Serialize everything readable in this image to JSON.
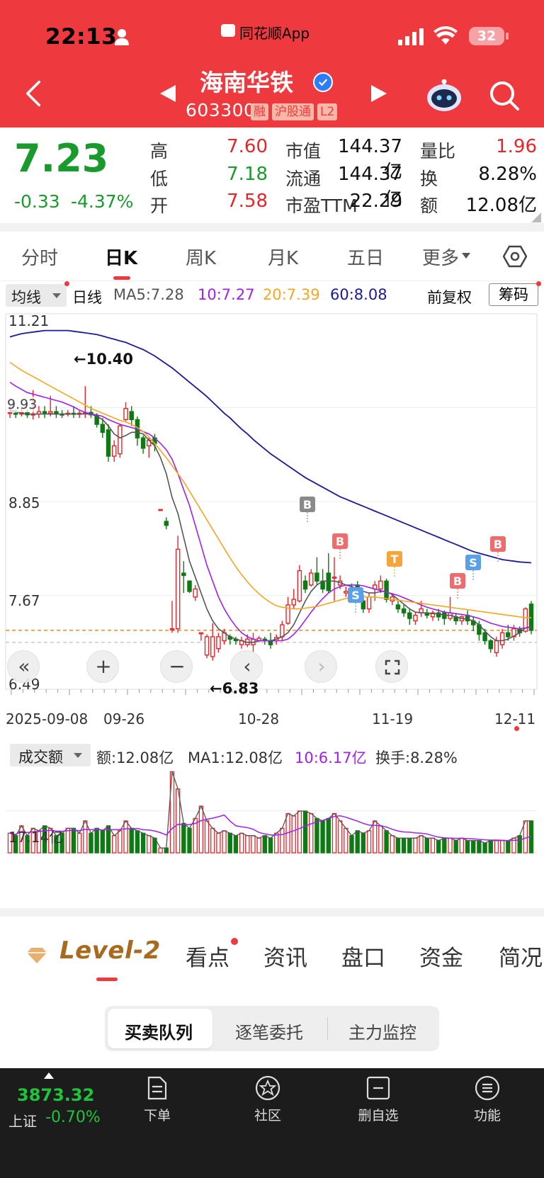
{
  "status_bar": {
    "time": "22:13",
    "app_label": "同花顺App",
    "battery": "32"
  },
  "header": {
    "stock_name": "海南华铁",
    "stock_code": "603300",
    "badges": [
      "融",
      "沪股通",
      "L2"
    ]
  },
  "quote": {
    "price": "7.23",
    "change": "-0.33",
    "change_pct": "-4.37%",
    "high_label": "高",
    "high": "7.60",
    "low_label": "低",
    "low": "7.18",
    "open_label": "开",
    "open": "7.58",
    "mktcap_label": "市值",
    "mktcap": "144.37亿",
    "float_label": "流通",
    "float_cap": "144.37亿",
    "pe_label": "市盈TTM",
    "pe": "22.29",
    "volratio_label": "量比",
    "volratio": "1.96",
    "turnover_label": "换",
    "turnover": "8.28%",
    "amount_label": "额",
    "amount": "12.08亿"
  },
  "period_tabs": [
    "分时",
    "日K",
    "周K",
    "月K",
    "五日",
    "更多"
  ],
  "ma_legend": {
    "selector": "均线",
    "period": "日线",
    "ma5": "MA5:7.28",
    "ma10": "10:7.27",
    "ma20": "20:7.39",
    "ma60": "60:8.08",
    "adjust": "前复权",
    "chip_button": "筹码"
  },
  "colors": {
    "up": "#e8252b",
    "down": "#0e7a14",
    "ma5": "#555555",
    "ma10": "#a020f0",
    "ma20": "#f5a623",
    "ma60": "#1a1a9c",
    "brand": "#ee3a3f"
  },
  "price_axis": {
    "top": "11.21",
    "mid": "8.85",
    "low": "7.67",
    "bottom": "6.49"
  },
  "annotations": {
    "high_marker": "←10.40",
    "low_marker": "←6.83",
    "price_tag": "9.93"
  },
  "date_axis": [
    "2025-09-08",
    "09-26",
    "10-28",
    "11-19",
    "12-11"
  ],
  "signal_tags": [
    "B",
    "B",
    "S",
    "T",
    "B",
    "S",
    "B"
  ],
  "volume_legend": {
    "selector": "成交额",
    "amount": "额:12.08亿",
    "ma1": "MA1:12.08亿",
    "ma10": "10:6.17亿",
    "turnover": "换手:8.28%",
    "axis_label": "17.14亿"
  },
  "chart_data": {
    "type": "candlestick",
    "title": "",
    "xlabel": "",
    "ylabel": "",
    "ylim": [
      6.49,
      11.21
    ],
    "x_ticks": [
      "2025-09-08",
      "09-26",
      "10-28",
      "11-19",
      "12-11"
    ],
    "candles": [
      [
        9.97,
        9.97,
        9.9,
        10.05
      ],
      [
        9.96,
        9.95,
        9.9,
        10.0
      ],
      [
        9.95,
        9.97,
        9.92,
        10.02
      ],
      [
        9.97,
        9.94,
        9.9,
        10.0
      ],
      [
        9.94,
        9.95,
        9.88,
        10.25
      ],
      [
        9.95,
        9.98,
        9.9,
        10.05
      ],
      [
        9.98,
        9.96,
        9.9,
        10.05
      ],
      [
        9.96,
        9.98,
        9.92,
        10.18
      ],
      [
        9.98,
        9.95,
        9.9,
        10.05
      ],
      [
        9.95,
        9.94,
        9.9,
        10.0
      ],
      [
        9.95,
        9.96,
        9.92,
        10.0
      ],
      [
        9.96,
        9.95,
        9.9,
        10.05
      ],
      [
        9.95,
        9.96,
        9.9,
        10.0
      ],
      [
        9.96,
        9.97,
        9.9,
        10.3
      ],
      [
        9.97,
        9.94,
        9.9,
        10.05
      ],
      [
        9.93,
        9.82,
        9.78,
        9.96
      ],
      [
        9.82,
        9.72,
        9.65,
        9.9
      ],
      [
        9.75,
        9.42,
        9.35,
        9.82
      ],
      [
        9.42,
        9.55,
        9.35,
        9.62
      ],
      [
        9.45,
        9.8,
        9.4,
        9.83
      ],
      [
        9.88,
        10.02,
        9.86,
        10.1
      ],
      [
        9.98,
        9.88,
        9.8,
        10.05
      ],
      [
        9.88,
        9.65,
        9.55,
        9.92
      ],
      [
        9.65,
        9.52,
        9.45,
        9.68
      ],
      [
        9.55,
        9.62,
        9.4,
        9.66
      ],
      [
        9.65,
        9.58,
        9.48,
        9.7
      ],
      [
        8.75,
        8.75,
        8.75,
        8.75
      ],
      [
        8.6,
        8.55,
        8.5,
        8.65
      ],
      [
        7.25,
        7.25,
        7.2,
        7.6
      ],
      [
        7.25,
        8.25,
        7.2,
        8.42
      ],
      [
        7.95,
        7.92,
        7.7,
        8.1
      ],
      [
        7.85,
        7.72,
        7.7,
        7.86
      ],
      [
        7.65,
        7.75,
        7.6,
        7.8
      ],
      [
        7.2,
        7.2,
        7.1,
        7.2
      ],
      [
        6.92,
        7.15,
        6.88,
        7.18
      ],
      [
        6.9,
        7.15,
        6.85,
        7.32
      ],
      [
        7.0,
        7.15,
        6.95,
        7.2
      ],
      [
        7.1,
        7.2,
        7.05,
        7.25
      ],
      [
        7.15,
        7.12,
        7.05,
        7.18
      ],
      [
        7.12,
        7.1,
        7.05,
        7.15
      ],
      [
        7.05,
        7.1,
        7.0,
        7.15
      ],
      [
        7.05,
        7.12,
        7.02,
        7.18
      ],
      [
        7.05,
        7.12,
        6.95,
        7.2
      ],
      [
        7.1,
        7.13,
        7.08,
        7.16
      ],
      [
        7.12,
        7.1,
        7.05,
        7.15
      ],
      [
        7.1,
        7.05,
        7.0,
        7.2
      ],
      [
        7.1,
        7.14,
        7.05,
        7.18
      ],
      [
        7.15,
        7.3,
        7.1,
        7.35
      ],
      [
        7.32,
        7.55,
        7.3,
        7.65
      ],
      [
        7.55,
        7.62,
        7.5,
        7.75
      ],
      [
        7.6,
        7.98,
        7.58,
        8.05
      ],
      [
        7.85,
        7.75,
        7.7,
        7.92
      ],
      [
        7.8,
        7.95,
        7.78,
        8.0
      ],
      [
        7.95,
        7.85,
        7.8,
        8.15
      ],
      [
        7.85,
        7.75,
        7.7,
        8.0
      ],
      [
        7.95,
        7.73,
        7.7,
        8.2
      ],
      [
        7.9,
        7.9,
        7.6,
        8.15
      ],
      [
        7.8,
        7.85,
        7.75,
        7.92
      ],
      [
        7.7,
        7.72,
        7.65,
        7.78
      ],
      [
        7.75,
        7.65,
        7.6,
        7.82
      ],
      [
        7.8,
        7.7,
        7.6,
        7.85
      ],
      [
        7.6,
        7.5,
        7.45,
        7.68
      ],
      [
        7.5,
        7.65,
        7.45,
        7.7
      ],
      [
        7.75,
        7.8,
        7.6,
        7.85
      ],
      [
        7.75,
        7.85,
        7.7,
        7.92
      ],
      [
        7.85,
        7.62,
        7.58,
        7.88
      ],
      [
        7.6,
        7.65,
        7.55,
        7.7
      ],
      [
        7.55,
        7.5,
        7.45,
        7.6
      ],
      [
        7.5,
        7.45,
        7.4,
        7.55
      ],
      [
        7.45,
        7.38,
        7.3,
        7.5
      ],
      [
        7.35,
        7.42,
        7.3,
        7.46
      ],
      [
        7.45,
        7.5,
        7.4,
        7.6
      ],
      [
        7.45,
        7.42,
        7.38,
        7.5
      ],
      [
        7.4,
        7.45,
        7.35,
        7.48
      ],
      [
        7.45,
        7.4,
        7.35,
        7.5
      ],
      [
        7.45,
        7.38,
        7.3,
        7.48
      ],
      [
        7.38,
        7.45,
        7.35,
        7.65
      ],
      [
        7.4,
        7.35,
        7.3,
        7.45
      ],
      [
        7.35,
        7.4,
        7.3,
        7.42
      ],
      [
        7.42,
        7.35,
        7.3,
        7.48
      ],
      [
        7.35,
        7.3,
        7.22,
        7.4
      ],
      [
        7.3,
        7.18,
        7.1,
        7.35
      ],
      [
        7.2,
        7.1,
        7.05,
        7.25
      ],
      [
        7.1,
        7.0,
        6.95,
        7.12
      ],
      [
        6.95,
        7.1,
        6.9,
        7.15
      ],
      [
        7.05,
        7.2,
        7.0,
        7.25
      ],
      [
        7.2,
        7.15,
        7.1,
        7.3
      ],
      [
        7.15,
        7.25,
        7.1,
        7.3
      ],
      [
        7.25,
        7.2,
        7.15,
        7.28
      ],
      [
        7.22,
        7.5,
        7.2,
        7.52
      ],
      [
        7.56,
        7.23,
        7.18,
        7.6
      ]
    ],
    "ma_series": [
      {
        "name": "MA5",
        "values": [
          10.0,
          9.98,
          9.96,
          9.95,
          9.95,
          9.95,
          9.95,
          9.95,
          9.95,
          9.95,
          9.95,
          9.95,
          9.95,
          9.95,
          9.95,
          9.92,
          9.88,
          9.8,
          9.7,
          9.65,
          9.68,
          9.72,
          9.72,
          9.7,
          9.62,
          9.55,
          9.4,
          9.2,
          8.9,
          8.7,
          8.4,
          8.1,
          7.9,
          7.7,
          7.5,
          7.35,
          7.25,
          7.2,
          7.15,
          7.12,
          7.1,
          7.08,
          7.08,
          7.1,
          7.1,
          7.1,
          7.12,
          7.15,
          7.2,
          7.3,
          7.45,
          7.6,
          7.72,
          7.8,
          7.85,
          7.85,
          7.85,
          7.83,
          7.8,
          7.78,
          7.75,
          7.72,
          7.7,
          7.7,
          7.72,
          7.72,
          7.68,
          7.62,
          7.56,
          7.5,
          7.46,
          7.45,
          7.45,
          7.44,
          7.44,
          7.42,
          7.42,
          7.4,
          7.38,
          7.37,
          7.35,
          7.3,
          7.22,
          7.15,
          7.1,
          7.1,
          7.12,
          7.16,
          7.2,
          7.26,
          7.28
        ]
      },
      {
        "name": "MA10",
        "values": [
          10.35,
          10.3,
          10.26,
          10.22,
          10.2,
          10.18,
          10.16,
          10.14,
          10.12,
          10.1,
          10.07,
          10.04,
          10.0,
          9.97,
          9.95,
          9.94,
          9.92,
          9.88,
          9.85,
          9.82,
          9.8,
          9.78,
          9.76,
          9.73,
          9.7,
          9.65,
          9.58,
          9.5,
          9.38,
          9.2,
          9.0,
          8.8,
          8.55,
          8.3,
          8.05,
          7.85,
          7.65,
          7.5,
          7.38,
          7.28,
          7.2,
          7.15,
          7.12,
          7.1,
          7.1,
          7.1,
          7.1,
          7.1,
          7.12,
          7.18,
          7.26,
          7.36,
          7.46,
          7.55,
          7.63,
          7.7,
          7.75,
          7.78,
          7.8,
          7.8,
          7.8,
          7.79,
          7.77,
          7.75,
          7.73,
          7.71,
          7.69,
          7.67,
          7.64,
          7.61,
          7.58,
          7.55,
          7.52,
          7.5,
          7.48,
          7.46,
          7.45,
          7.44,
          7.43,
          7.42,
          7.4,
          7.38,
          7.35,
          7.32,
          7.3,
          7.28,
          7.27,
          7.26,
          7.25,
          7.26,
          7.27
        ]
      },
      {
        "name": "MA20",
        "values": [
          10.6,
          10.55,
          10.5,
          10.46,
          10.42,
          10.38,
          10.34,
          10.3,
          10.26,
          10.22,
          10.18,
          10.14,
          10.1,
          10.06,
          10.02,
          9.99,
          9.96,
          9.93,
          9.9,
          9.87,
          9.85,
          9.82,
          9.78,
          9.73,
          9.66,
          9.58,
          9.49,
          9.4,
          9.3,
          9.2,
          9.1,
          8.98,
          8.86,
          8.74,
          8.62,
          8.5,
          8.38,
          8.26,
          8.14,
          8.03,
          7.93,
          7.84,
          7.76,
          7.69,
          7.63,
          7.58,
          7.54,
          7.52,
          7.51,
          7.5,
          7.5,
          7.51,
          7.52,
          7.53,
          7.55,
          7.57,
          7.59,
          7.61,
          7.63,
          7.64,
          7.65,
          7.65,
          7.65,
          7.65,
          7.64,
          7.63,
          7.62,
          7.61,
          7.6,
          7.59,
          7.58,
          7.57,
          7.56,
          7.55,
          7.54,
          7.53,
          7.52,
          7.51,
          7.5,
          7.49,
          7.48,
          7.47,
          7.46,
          7.45,
          7.44,
          7.43,
          7.42,
          7.41,
          7.4,
          7.39,
          7.39
        ]
      },
      {
        "name": "MA60",
        "values": [
          10.92,
          10.94,
          10.96,
          10.97,
          10.98,
          10.99,
          11.0,
          11.0,
          11.0,
          11.0,
          11.0,
          10.99,
          10.98,
          10.97,
          10.96,
          10.95,
          10.93,
          10.91,
          10.89,
          10.87,
          10.85,
          10.82,
          10.79,
          10.76,
          10.72,
          10.68,
          10.63,
          10.58,
          10.53,
          10.47,
          10.41,
          10.35,
          10.29,
          10.23,
          10.17,
          10.1,
          10.03,
          9.96,
          9.9,
          9.83,
          9.76,
          9.7,
          9.63,
          9.57,
          9.51,
          9.45,
          9.4,
          9.35,
          9.3,
          9.25,
          9.2,
          9.15,
          9.11,
          9.07,
          9.03,
          8.99,
          8.95,
          8.91,
          8.88,
          8.85,
          8.82,
          8.79,
          8.76,
          8.73,
          8.7,
          8.67,
          8.64,
          8.61,
          8.58,
          8.55,
          8.52,
          8.49,
          8.46,
          8.43,
          8.4,
          8.37,
          8.34,
          8.31,
          8.28,
          8.25,
          8.22,
          8.2,
          8.18,
          8.16,
          8.14,
          8.12,
          8.11,
          8.1,
          8.09,
          8.085,
          8.08
        ]
      }
    ],
    "volume_ylim": [
      0,
      34
    ],
    "volume_values": [
      8,
      7,
      11,
      7,
      10,
      9,
      11,
      10,
      7,
      8,
      10,
      10,
      8,
      13,
      8,
      10,
      9,
      11,
      7,
      9,
      13,
      10,
      9,
      8,
      7,
      6,
      2,
      2,
      33,
      26,
      12,
      10,
      14,
      19,
      13,
      10,
      8,
      9,
      8,
      7,
      8,
      7,
      7,
      6,
      7,
      6,
      8,
      10,
      16,
      15,
      17,
      17,
      16,
      14,
      13,
      14,
      16,
      13,
      10,
      7,
      9,
      8,
      9,
      13,
      11,
      9,
      7,
      6,
      6,
      6,
      6,
      7,
      6,
      6,
      5,
      6,
      6,
      5,
      6,
      5,
      5,
      5,
      4,
      5,
      5,
      5,
      5,
      6,
      7,
      13,
      13
    ]
  },
  "info_tabs": {
    "level2": "Level-2",
    "items": [
      "看点",
      "资讯",
      "盘口",
      "资金",
      "简况"
    ]
  },
  "queue_tabs": [
    "买卖队列",
    "逐笔委托",
    "主力监控"
  ],
  "bottom_nav": {
    "index_value": "3873.32",
    "index_name": "上证",
    "index_change": "-0.70%",
    "items": [
      "下单",
      "社区",
      "删自选",
      "功能"
    ]
  }
}
